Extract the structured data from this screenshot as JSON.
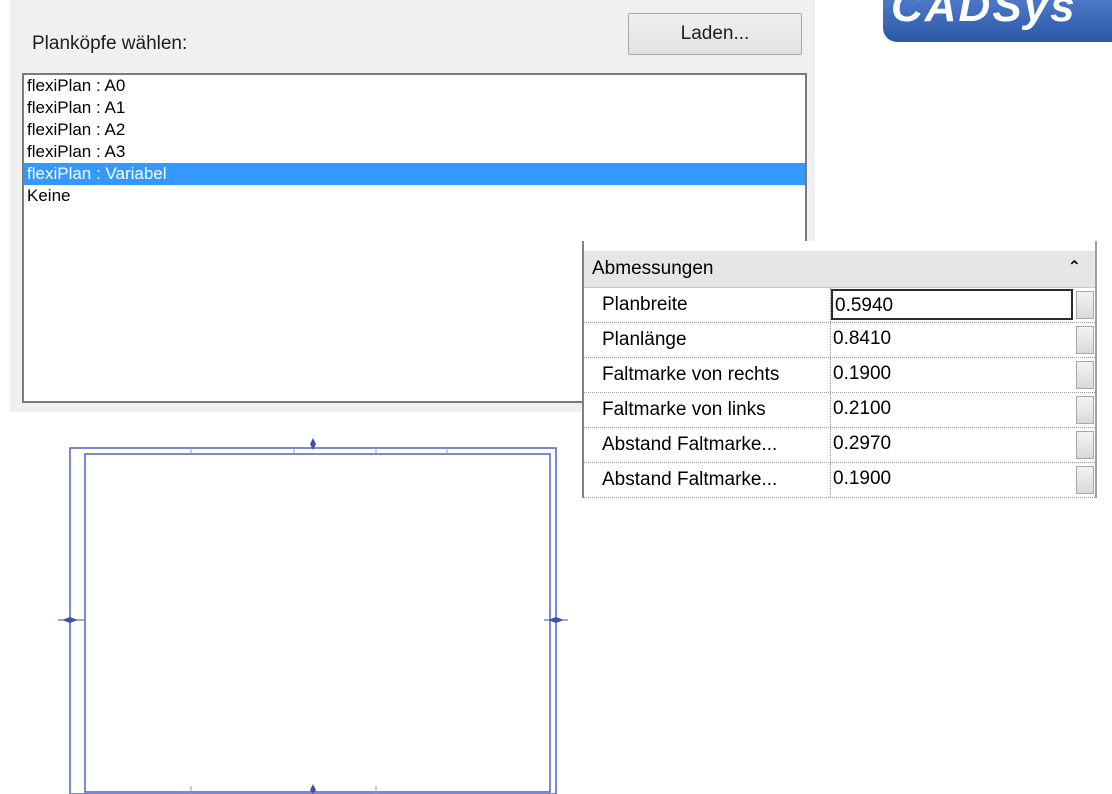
{
  "dialog": {
    "label": "Planköpfe wählen:",
    "load_button": "Laden...",
    "items": [
      {
        "label": "flexiPlan : A0",
        "selected": false
      },
      {
        "label": "flexiPlan : A1",
        "selected": false
      },
      {
        "label": "flexiPlan : A2",
        "selected": false
      },
      {
        "label": "flexiPlan : A3",
        "selected": false
      },
      {
        "label": "flexiPlan : Variabel",
        "selected": true
      },
      {
        "label": "Keine",
        "selected": false
      }
    ]
  },
  "logo": {
    "text": "CADSys"
  },
  "properties": {
    "title": "Abmessungen",
    "collapse_icon": "double-chevron-up-icon",
    "rows": [
      {
        "name": "Planbreite",
        "value": "0.5940"
      },
      {
        "name": "Planlänge",
        "value": "0.8410"
      },
      {
        "name": "Faltmarke von rechts",
        "value": "0.1900"
      },
      {
        "name": "Faltmarke von links",
        "value": "0.2100"
      },
      {
        "name": "Abstand Faltmarke...",
        "value": "0.2970"
      },
      {
        "name": "Abstand Faltmarke...",
        "value": "0.1900"
      }
    ]
  },
  "colors": {
    "selection": "#3399ff",
    "sheet_border": "#5060c0",
    "logo": "#2c58a8"
  }
}
